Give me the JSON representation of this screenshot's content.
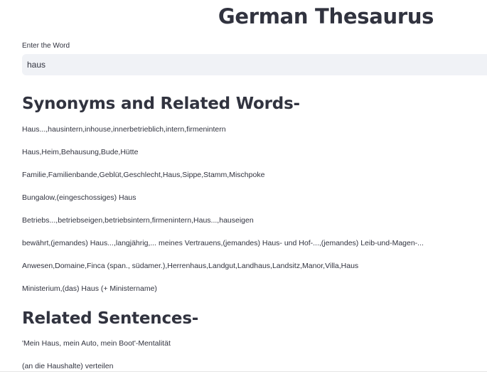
{
  "header": {
    "title": "German Thesaurus"
  },
  "search": {
    "label": "Enter the Word",
    "value": "haus"
  },
  "synonyms": {
    "heading": "Synonyms and Related Words-",
    "items": [
      "Haus...,hausintern,inhouse,innerbetrieblich,intern,firmenintern",
      "Haus,Heim,Behausung,Bude,Hütte",
      "Familie,Familienbande,Geblüt,Geschlecht,Haus,Sippe,Stamm,Mischpoke",
      "Bungalow,(eingeschossiges) Haus",
      "Betriebs...,betriebseigen,betriebsintern,firmenintern,Haus...,hauseigen",
      "bewährt,(jemandes) Haus...,langjährig,... meines Vertrauens,(jemandes) Haus- und Hof-...,(jemandes) Leib-und-Magen-...",
      "Anwesen,Domaine,Finca (span., südamer.),Herrenhaus,Landgut,Landhaus,Landsitz,Manor,Villa,Haus",
      "Ministerium,(das) Haus (+ Ministername)"
    ]
  },
  "sentences": {
    "heading": "Related Sentences-",
    "items": [
      "'Mein Haus, mein Auto, mein Boot'-Mentalität",
      "(an die Haushalte) verteilen"
    ]
  }
}
